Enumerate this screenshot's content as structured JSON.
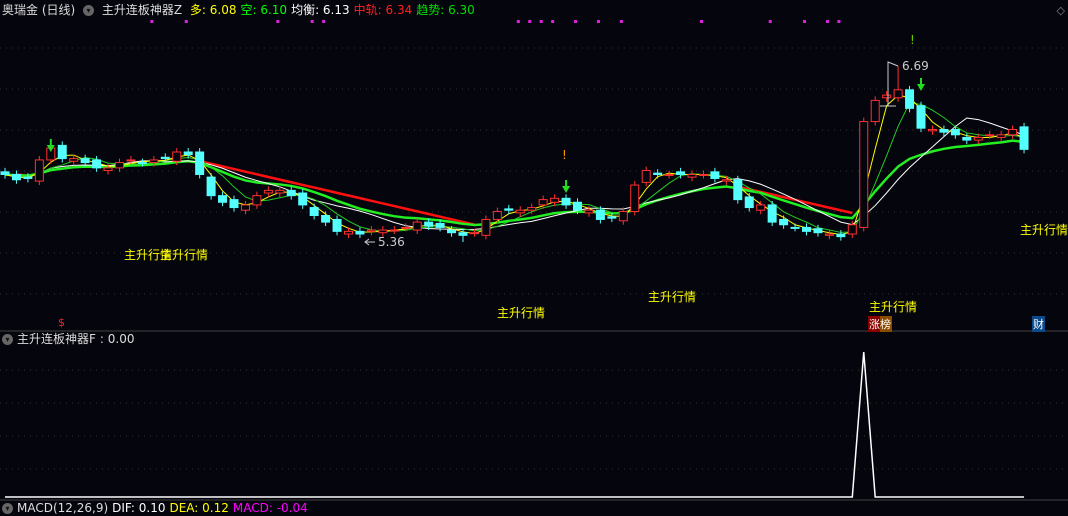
{
  "header": {
    "stock": "奥瑞金 (日线)",
    "indicator": "主升连板神器Z",
    "items": [
      {
        "label": "多",
        "value": "6.08",
        "color": "#ffff00"
      },
      {
        "label": "空",
        "value": "6.10",
        "color": "#00ff00"
      },
      {
        "label": "均衡",
        "value": "6.13",
        "color": "#ffffff"
      },
      {
        "label": "中轨",
        "value": "6.34",
        "color": "#ff2020"
      },
      {
        "label": "趋势",
        "value": "6.30",
        "color": "#00e000"
      }
    ]
  },
  "sub_header": {
    "indicator": "主升连板神器F",
    "value": "0.00"
  },
  "macd_header": {
    "name": "MACD(12,26,9)",
    "dif": "DIF: 0.10",
    "dea": "DEA: 0.12",
    "macd": "MACD: -0.04"
  },
  "annotations": {
    "high": "6.69",
    "low": "5.36",
    "signal": "主升行情",
    "mark_dollar": "$",
    "mark_zhang": "涨榜",
    "mark_cai": "财",
    "excl": "!"
  },
  "chart_data": {
    "type": "candlestick",
    "high_price": 6.69,
    "low_price": 5.36,
    "closes": [
      5.87,
      5.83,
      5.84,
      5.98,
      6.07,
      5.99,
      5.99,
      5.96,
      5.92,
      5.92,
      5.96,
      5.98,
      5.96,
      5.98,
      5.99,
      6.04,
      6.02,
      5.87,
      5.71,
      5.66,
      5.62,
      5.64,
      5.71,
      5.75,
      5.75,
      5.71,
      5.64,
      5.56,
      5.51,
      5.44,
      5.44,
      5.42,
      5.45,
      5.45,
      5.45,
      5.47,
      5.51,
      5.48,
      5.47,
      5.43,
      5.41,
      5.43,
      5.53,
      5.59,
      5.6,
      5.6,
      5.62,
      5.68,
      5.69,
      5.64,
      5.6,
      5.6,
      5.53,
      5.54,
      5.59,
      5.79,
      5.9,
      5.87,
      5.87,
      5.87,
      5.87,
      5.87,
      5.84,
      5.83,
      5.68,
      5.62,
      5.64,
      5.51,
      5.49,
      5.47,
      5.44,
      5.43,
      5.42,
      5.4,
      5.49,
      6.27,
      6.43,
      6.47,
      6.51,
      6.37,
      6.22,
      6.21,
      6.19,
      6.17,
      6.13,
      6.15,
      6.17,
      6.17,
      6.21,
      6.06
    ],
    "sub_indicator": {
      "spike_index": 75,
      "spike_value": 1,
      "baseline": 0
    }
  }
}
